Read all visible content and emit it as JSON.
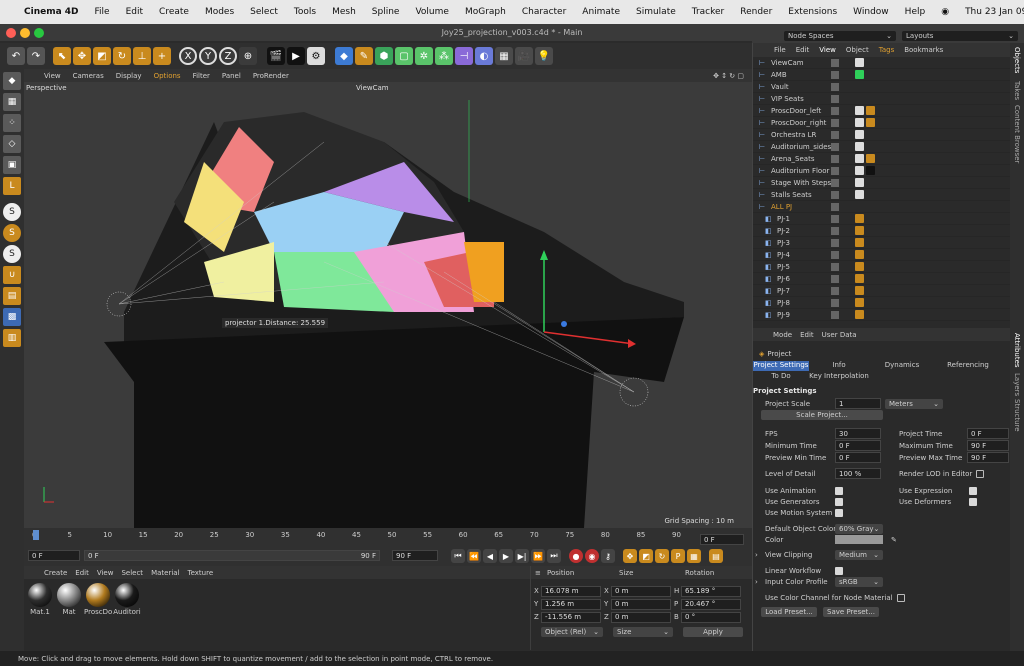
{
  "macos": {
    "app": "Cinema 4D",
    "menus": [
      "File",
      "Edit",
      "Create",
      "Modes",
      "Select",
      "Tools",
      "Mesh",
      "Spline",
      "Volume",
      "MoGraph",
      "Character",
      "Animate",
      "Simulate",
      "Tracker",
      "Render",
      "Extensions",
      "Window",
      "Help"
    ],
    "datetime": "Thu 23 Jan  09:24"
  },
  "window": {
    "title": "Joy25_projection_v003.c4d * - Main"
  },
  "toolbar": {
    "node_spaces": "Node Spaces",
    "layouts": "Layouts"
  },
  "viewport": {
    "menus": [
      "View",
      "Cameras",
      "Display",
      "Options",
      "Filter",
      "Panel",
      "ProRender"
    ],
    "label": "Perspective",
    "camera": "ViewCam",
    "hud": "projector 1.Distance:   25.559",
    "grid": "Grid Spacing : 10 m"
  },
  "timeline": {
    "ticks": [
      "0",
      "5",
      "10",
      "15",
      "20",
      "25",
      "30",
      "35",
      "40",
      "45",
      "50",
      "55",
      "60",
      "65",
      "70",
      "75",
      "80",
      "85",
      "90"
    ],
    "frame": "0 F",
    "start": "0 F",
    "range_start": "0 F",
    "range_end": "90 F",
    "end": "90 F"
  },
  "materials": {
    "menus": [
      "Create",
      "Edit",
      "View",
      "Select",
      "Material",
      "Texture"
    ],
    "items": [
      {
        "name": "Mat.1",
        "color": "#2e2e2e"
      },
      {
        "name": "Mat",
        "color": "#8a8a8a"
      },
      {
        "name": "ProscDo",
        "color": "#b07a1e"
      },
      {
        "name": "Auditori",
        "color": "#1a1a1a"
      }
    ]
  },
  "coords": {
    "headers": [
      "Position",
      "Size",
      "Rotation"
    ],
    "rows": [
      {
        "a": "X",
        "p": "16.078 m",
        "s": "X",
        "sv": "0 m",
        "r": "H",
        "rv": "65.189 °"
      },
      {
        "a": "Y",
        "p": "1.256 m",
        "s": "Y",
        "sv": "0 m",
        "r": "P",
        "rv": "20.467 °"
      },
      {
        "a": "Z",
        "p": "-11.556 m",
        "s": "Z",
        "sv": "0 m",
        "r": "B",
        "rv": "0 °"
      }
    ],
    "mode": "Object (Rel)",
    "size_mode": "Size",
    "apply": "Apply"
  },
  "status": "Move: Click and drag to move elements. Hold down SHIFT to quantize movement / add to the selection in point mode, CTRL to remove.",
  "objects": {
    "menus": [
      "File",
      "Edit",
      "View",
      "Object",
      "Tags",
      "Bookmarks"
    ],
    "items": [
      "ViewCam",
      "AMB",
      "Vault",
      "VIP Seats",
      "ProscDoor_left",
      "ProscDoor_right",
      "Orchestra LR",
      "Auditorium_sides",
      "Arena_Seats",
      "Auditorium Floor",
      "Stage With Steps",
      "Stalls Seats",
      "ALL PJ",
      "PJ-1",
      "PJ-2",
      "PJ-3",
      "PJ-4",
      "PJ-5",
      "PJ-6",
      "PJ-7",
      "PJ-8",
      "PJ-9"
    ]
  },
  "attributes": {
    "menus": [
      "Mode",
      "Edit",
      "User Data"
    ],
    "object": "Project",
    "tabs": [
      "Project Settings",
      "Info",
      "Dynamics",
      "Referencing",
      "To Do",
      "Key Interpolation"
    ],
    "section": "Project Settings",
    "scale_label": "Project Scale",
    "scale_value": "1",
    "scale_unit": "Meters",
    "scale_btn": "Scale Project...",
    "fps_label": "FPS",
    "fps": "30",
    "ptime_label": "Project Time",
    "ptime": "0 F",
    "mintime_label": "Minimum Time",
    "mintime": "0 F",
    "maxtime_label": "Maximum Time",
    "maxtime": "90 F",
    "pmin_label": "Preview Min Time",
    "pmin": "0 F",
    "pmax_label": "Preview Max Time",
    "pmax": "90 F",
    "lod_label": "Level of Detail",
    "lod": "100 %",
    "rlod_label": "Render LOD in Editor",
    "useanim": "Use Animation",
    "useexpr": "Use Expression",
    "usegen": "Use Generators",
    "usedef": "Use Deformers",
    "usemo": "Use Motion System",
    "defcol_label": "Default Object Color",
    "defcol": "60% Gray",
    "color_label": "Color",
    "clip_label": "View Clipping",
    "clip": "Medium",
    "linear_label": "Linear Workflow",
    "profile_label": "Input Color Profile",
    "profile": "sRGB",
    "usecol_label": "Use Color Channel for Node Material",
    "load": "Load Preset...",
    "save": "Save Preset..."
  },
  "right_tabs": [
    "Objects",
    "Takes",
    "Content Browser",
    "Attributes",
    "Layers",
    "Structure"
  ]
}
